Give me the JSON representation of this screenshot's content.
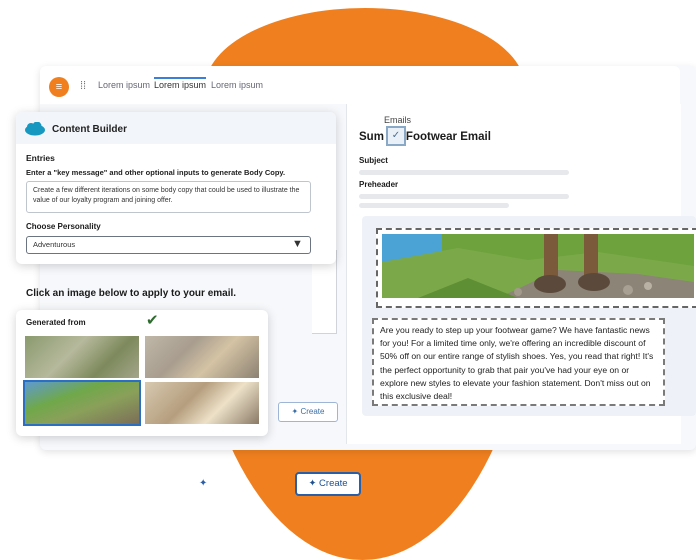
{
  "topbar": {
    "tabs": [
      "Lorem ipsum",
      "Lorem ipsum",
      "Lorem ipsum"
    ]
  },
  "content_builder": {
    "title": "Content Builder",
    "entries_label": "Entries",
    "entries_instruction": "Enter a \"key message\" and other optional inputs to generate Body Copy.",
    "entries_value": "Create a few different iterations on some body copy that could be used to illustrate the value of our loyalty program and joining offer.",
    "personality_label": "Choose Personality",
    "personality_value": "Adventurous"
  },
  "images": {
    "heading": "Click an image below to apply to your email.",
    "generated_label": "Generated from"
  },
  "email": {
    "breadcrumb": "Emails",
    "title_left": "Sum",
    "title_right": "Footwear Email",
    "subject_label": "Subject",
    "preheader_label": "Preheader",
    "body": "Are you ready to step up your footwear game? We have fantastic news for you! For a limited time only, we're offering an incredible discount of 50% off on our entire range of stylish shoes. Yes, you read that right! It's the perfect opportunity to grab that pair you've had your eye on or explore new styles to elevate your fashion statement. Don't miss out on this exclusive deal!"
  },
  "buttons": {
    "create_label": "Create",
    "create_small_label": "Create"
  },
  "colors": {
    "accent_orange": "#f0801f",
    "brand_blue": "#2a5fa8"
  }
}
